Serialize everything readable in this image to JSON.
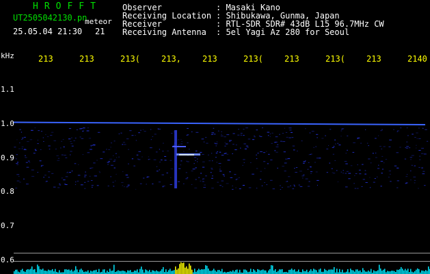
{
  "header": {
    "brand": "HROFFT",
    "filename": "UT2505042130.pn",
    "meteor_label": "meteor",
    "datetime": "25.05.04 21:30",
    "meteor_count": "21",
    "info": [
      {
        "key": "Observer",
        "value": ": Masaki Kano"
      },
      {
        "key": "Receiving Location",
        "value": ": Shibukawa, Gunma, Japan"
      },
      {
        "key": "Receiver",
        "value": ": RTL-SDR SDR# 43dB L15 96.7MHz CW"
      },
      {
        "key": "Receiving Antenna",
        "value": ": 5el Yagi Az 280 for Seoul"
      }
    ]
  },
  "axes": {
    "y_unit": "kHz",
    "x_ticks": [
      "213",
      "213",
      "213(",
      "213,",
      "213",
      "213(",
      "213",
      "213(",
      "213",
      "2140"
    ],
    "y_ticks": [
      "1.1",
      "1.0",
      "0.9",
      "0.8",
      "0.7",
      "0.6"
    ]
  },
  "colors": {
    "background": "#000000",
    "signal": "#2a3cff",
    "carrier": "#3a64ff",
    "spectrum_cyan": "#00e8ff",
    "spectrum_yellow": "#ffff00",
    "label_green": "#00e000",
    "label_white": "#ffffff"
  }
}
